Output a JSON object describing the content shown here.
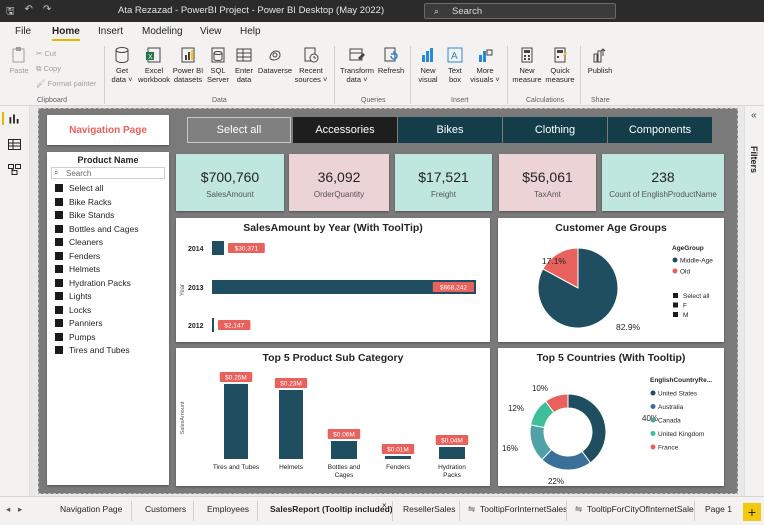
{
  "window": {
    "title": "Ata Rezazad - PowerBI Project - Power BI Desktop (May 2022)",
    "search_placeholder": "Search"
  },
  "ribbon_tabs": [
    "File",
    "Home",
    "Insert",
    "Modeling",
    "View",
    "Help"
  ],
  "ribbon": {
    "clipboard": {
      "paste": "Paste",
      "cut": "Cut",
      "copy": "Copy",
      "format_painter": "Format painter",
      "label": "Clipboard"
    },
    "data": {
      "buttons": [
        {
          "l1": "Get",
          "l2": "data ˅"
        },
        {
          "l1": "Excel",
          "l2": "workbook"
        },
        {
          "l1": "Power BI",
          "l2": "datasets"
        },
        {
          "l1": "SQL",
          "l2": "Server"
        },
        {
          "l1": "Enter",
          "l2": "data"
        },
        {
          "l1": "Dataverse",
          "l2": ""
        },
        {
          "l1": "Recent",
          "l2": "sources ˅"
        }
      ],
      "label": "Data"
    },
    "queries": {
      "buttons": [
        {
          "l1": "Transform",
          "l2": "data ˅"
        },
        {
          "l1": "Refresh",
          "l2": ""
        }
      ],
      "label": "Queries"
    },
    "insert": {
      "buttons": [
        {
          "l1": "New",
          "l2": "visual"
        },
        {
          "l1": "Text",
          "l2": "box"
        },
        {
          "l1": "More",
          "l2": "visuals ˅"
        }
      ],
      "label": "Insert"
    },
    "calculations": {
      "buttons": [
        {
          "l1": "New",
          "l2": "measure"
        },
        {
          "l1": "Quick",
          "l2": "measure"
        }
      ],
      "label": "Calculations"
    },
    "share": {
      "buttons": [
        {
          "l1": "Publish",
          "l2": ""
        }
      ],
      "label": "Share"
    }
  },
  "filters_label": "Filters",
  "nav_title": "Navigation Page",
  "nav_buttons": [
    "Select all",
    "Accessories",
    "Bikes",
    "Clothing",
    "Components"
  ],
  "slicer": {
    "title": "Product Name",
    "search_placeholder": "Search",
    "items": [
      "Select all",
      "Bike Racks",
      "Bike Stands",
      "Bottles and Cages",
      "Cleaners",
      "Fenders",
      "Helmets",
      "Hydration Packs",
      "Lights",
      "Locks",
      "Panniers",
      "Pumps",
      "Tires and Tubes"
    ]
  },
  "kpis": [
    {
      "value": "$700,760",
      "label": "SalesAmount"
    },
    {
      "value": "36,092",
      "label": "OrderQuantity"
    },
    {
      "value": "$17,521",
      "label": "Freight"
    },
    {
      "value": "$56,061",
      "label": "TaxAmt"
    },
    {
      "value": "238",
      "label": "Count of EnglishProductName"
    }
  ],
  "colors": {
    "teal_dark": "#1e4e5f",
    "teal_light": "#bfe6df",
    "pink_light": "#ecd3d6",
    "red": "#e8615c",
    "gray_btn": "#808080",
    "dark_btn": "#1e1e1e",
    "navy_btn": "#133d49"
  },
  "chart_data": [
    {
      "type": "bar",
      "orientation": "horizontal",
      "title": "SalesAmount by Year (With ToolTip)",
      "ylabel": "Year",
      "categories": [
        "2014",
        "2013",
        "2012"
      ],
      "values": [
        30371,
        668242,
        2147
      ],
      "data_labels": [
        "$30,371",
        "$668,242",
        "$2,147"
      ]
    },
    {
      "type": "pie",
      "title": "Customer Age Groups",
      "legend_title": "AgeGroup",
      "categories": [
        "Middle-Age",
        "Old"
      ],
      "values": [
        82.9,
        17.1
      ],
      "data_labels": [
        "82.9%",
        "17.1%"
      ],
      "colors": [
        "#1e4e5f",
        "#e8615c"
      ],
      "gender_slicer": [
        "Select all",
        "F",
        "M"
      ]
    },
    {
      "type": "bar",
      "title": "Top 5 Product Sub Category",
      "ylabel": "SalesAmount",
      "categories": [
        "Tires and Tubes",
        "Helmets",
        "Bottles and Cages",
        "Fenders",
        "Hydration Packs"
      ],
      "values": [
        0.25,
        0.23,
        0.06,
        0.01,
        0.04
      ],
      "data_labels": [
        "$0.25M",
        "$0.23M",
        "$0.06M",
        "$0.01M",
        "$0.04M"
      ]
    },
    {
      "type": "pie",
      "subtype": "donut",
      "title": "Top 5 Countries (With Tooltip)",
      "legend_title": "EnglishCountryRe...",
      "categories": [
        "United States",
        "Australia",
        "Canada",
        "United Kingdom",
        "France"
      ],
      "values": [
        40,
        22,
        16,
        12,
        10
      ],
      "data_labels": [
        "40%",
        "22%",
        "16%",
        "12%",
        "10%"
      ],
      "colors": [
        "#1e4e5f",
        "#3a6f9a",
        "#4fa3a8",
        "#3dbf9a",
        "#e8615c"
      ]
    }
  ],
  "page_tabs": [
    {
      "label": "Navigation Page",
      "active": false
    },
    {
      "label": "Customers",
      "active": false
    },
    {
      "label": "Employees",
      "active": false
    },
    {
      "label": "SalesReport (Tooltip included)",
      "active": true
    },
    {
      "label": "ResellerSales",
      "active": false
    },
    {
      "label": "TooltipForInternetSales",
      "active": false
    },
    {
      "label": "TooltipForCityOfInternetSale",
      "active": false
    },
    {
      "label": "Page 1",
      "active": false
    }
  ]
}
